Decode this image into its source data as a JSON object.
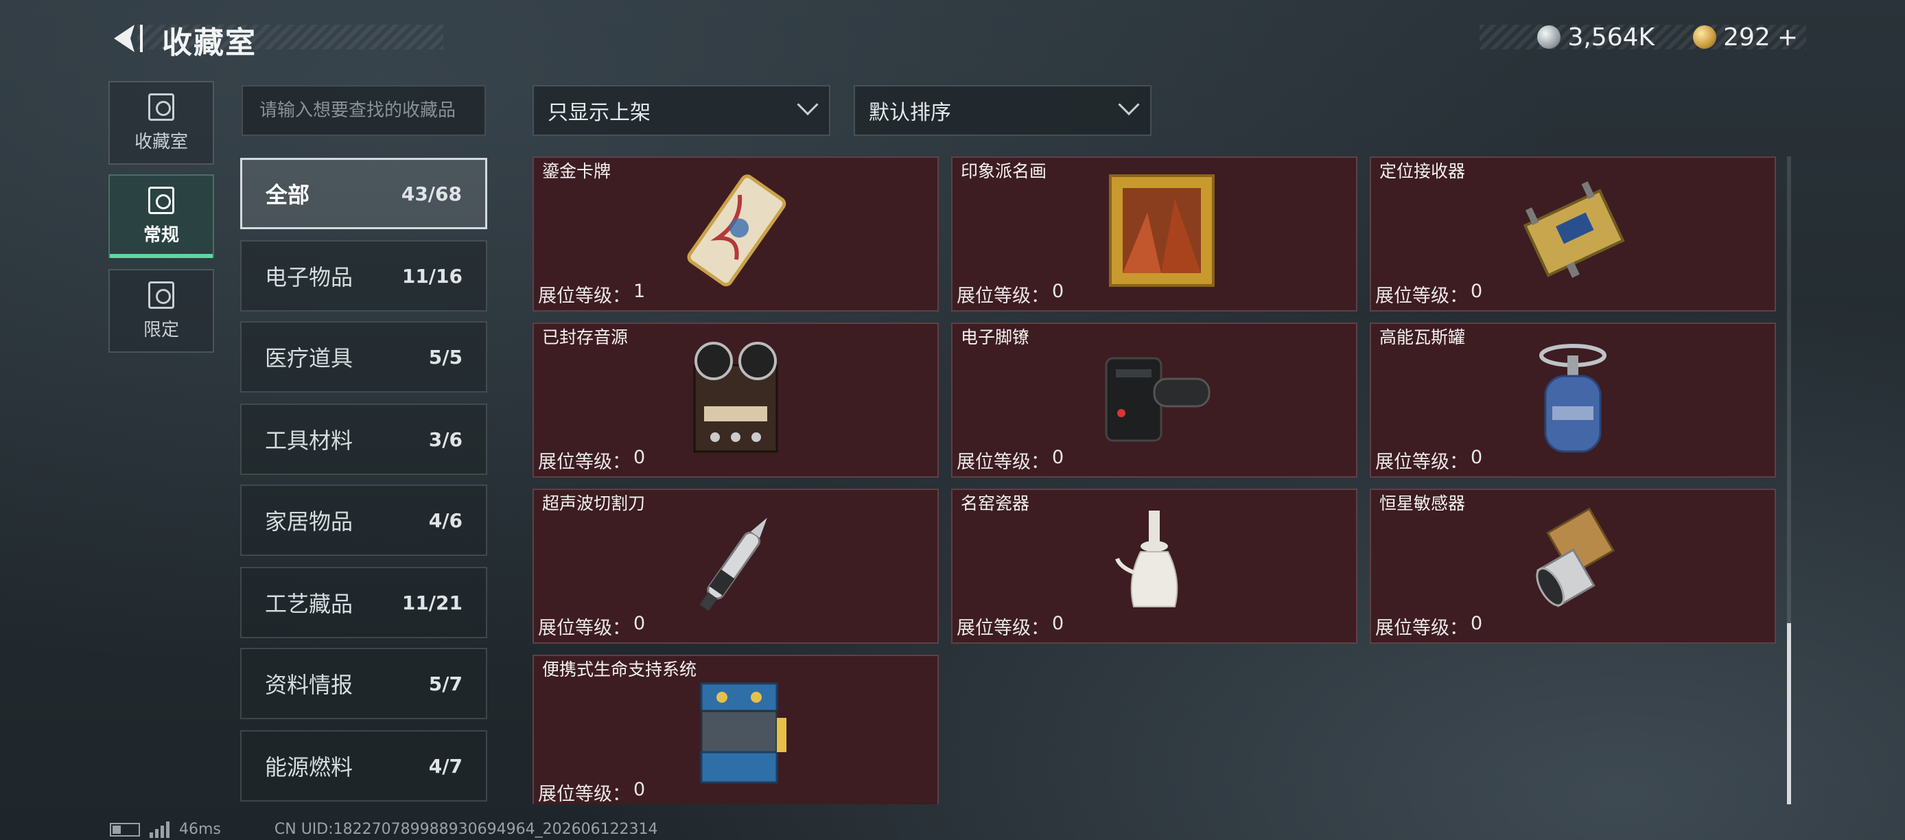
{
  "header": {
    "title": "收藏室",
    "currency": [
      {
        "icon": "silver-coin-icon",
        "value": "3,564K"
      },
      {
        "icon": "gold-coin-icon",
        "value": "292"
      }
    ],
    "add_label": "+"
  },
  "side_tabs": [
    {
      "label": "收藏室",
      "icon": "collection-room-icon",
      "active": false
    },
    {
      "label": "常规",
      "icon": "regular-icon",
      "active": true
    },
    {
      "label": "限定",
      "icon": "limited-icon",
      "active": false
    }
  ],
  "search": {
    "placeholder": "请输入想要查找的收藏品"
  },
  "filters": {
    "display": "只显示上架",
    "sort": "默认排序"
  },
  "categories": [
    {
      "label": "全部",
      "count": "43/68",
      "active": true
    },
    {
      "label": "电子物品",
      "count": "11/16"
    },
    {
      "label": "医疗道具",
      "count": "5/5"
    },
    {
      "label": "工具材料",
      "count": "3/6"
    },
    {
      "label": "家居物品",
      "count": "4/6"
    },
    {
      "label": "工艺藏品",
      "count": "11/21"
    },
    {
      "label": "资料情报",
      "count": "5/7"
    },
    {
      "label": "能源燃料",
      "count": "4/7"
    }
  ],
  "level_label": "展位等级：",
  "items": [
    {
      "name": "鎏金卡牌",
      "level": "1",
      "icon": "gilded-card-icon"
    },
    {
      "name": "印象派名画",
      "level": "0",
      "icon": "framed-painting-icon"
    },
    {
      "name": "定位接收器",
      "level": "0",
      "icon": "locator-receiver-icon"
    },
    {
      "name": "已封存音源",
      "level": "0",
      "icon": "reel-to-reel-recorder-icon"
    },
    {
      "name": "电子脚镣",
      "level": "0",
      "icon": "electronic-ankle-monitor-icon"
    },
    {
      "name": "高能瓦斯罐",
      "level": "0",
      "icon": "gas-canister-icon"
    },
    {
      "name": "超声波切割刀",
      "level": "0",
      "icon": "ultrasonic-cutter-icon"
    },
    {
      "name": "名窑瓷器",
      "level": "0",
      "icon": "porcelain-vase-icon"
    },
    {
      "name": "恒星敏感器",
      "level": "0",
      "icon": "star-sensor-icon"
    },
    {
      "name": "便携式生命支持系统",
      "level": "0",
      "icon": "life-support-system-icon"
    }
  ],
  "footer": {
    "ping": "46ms",
    "uid": "CN UID:182270789988930694964_202606122314"
  },
  "colors": {
    "accent": "#5fd7a0",
    "card_bg": "#3d1d22"
  }
}
